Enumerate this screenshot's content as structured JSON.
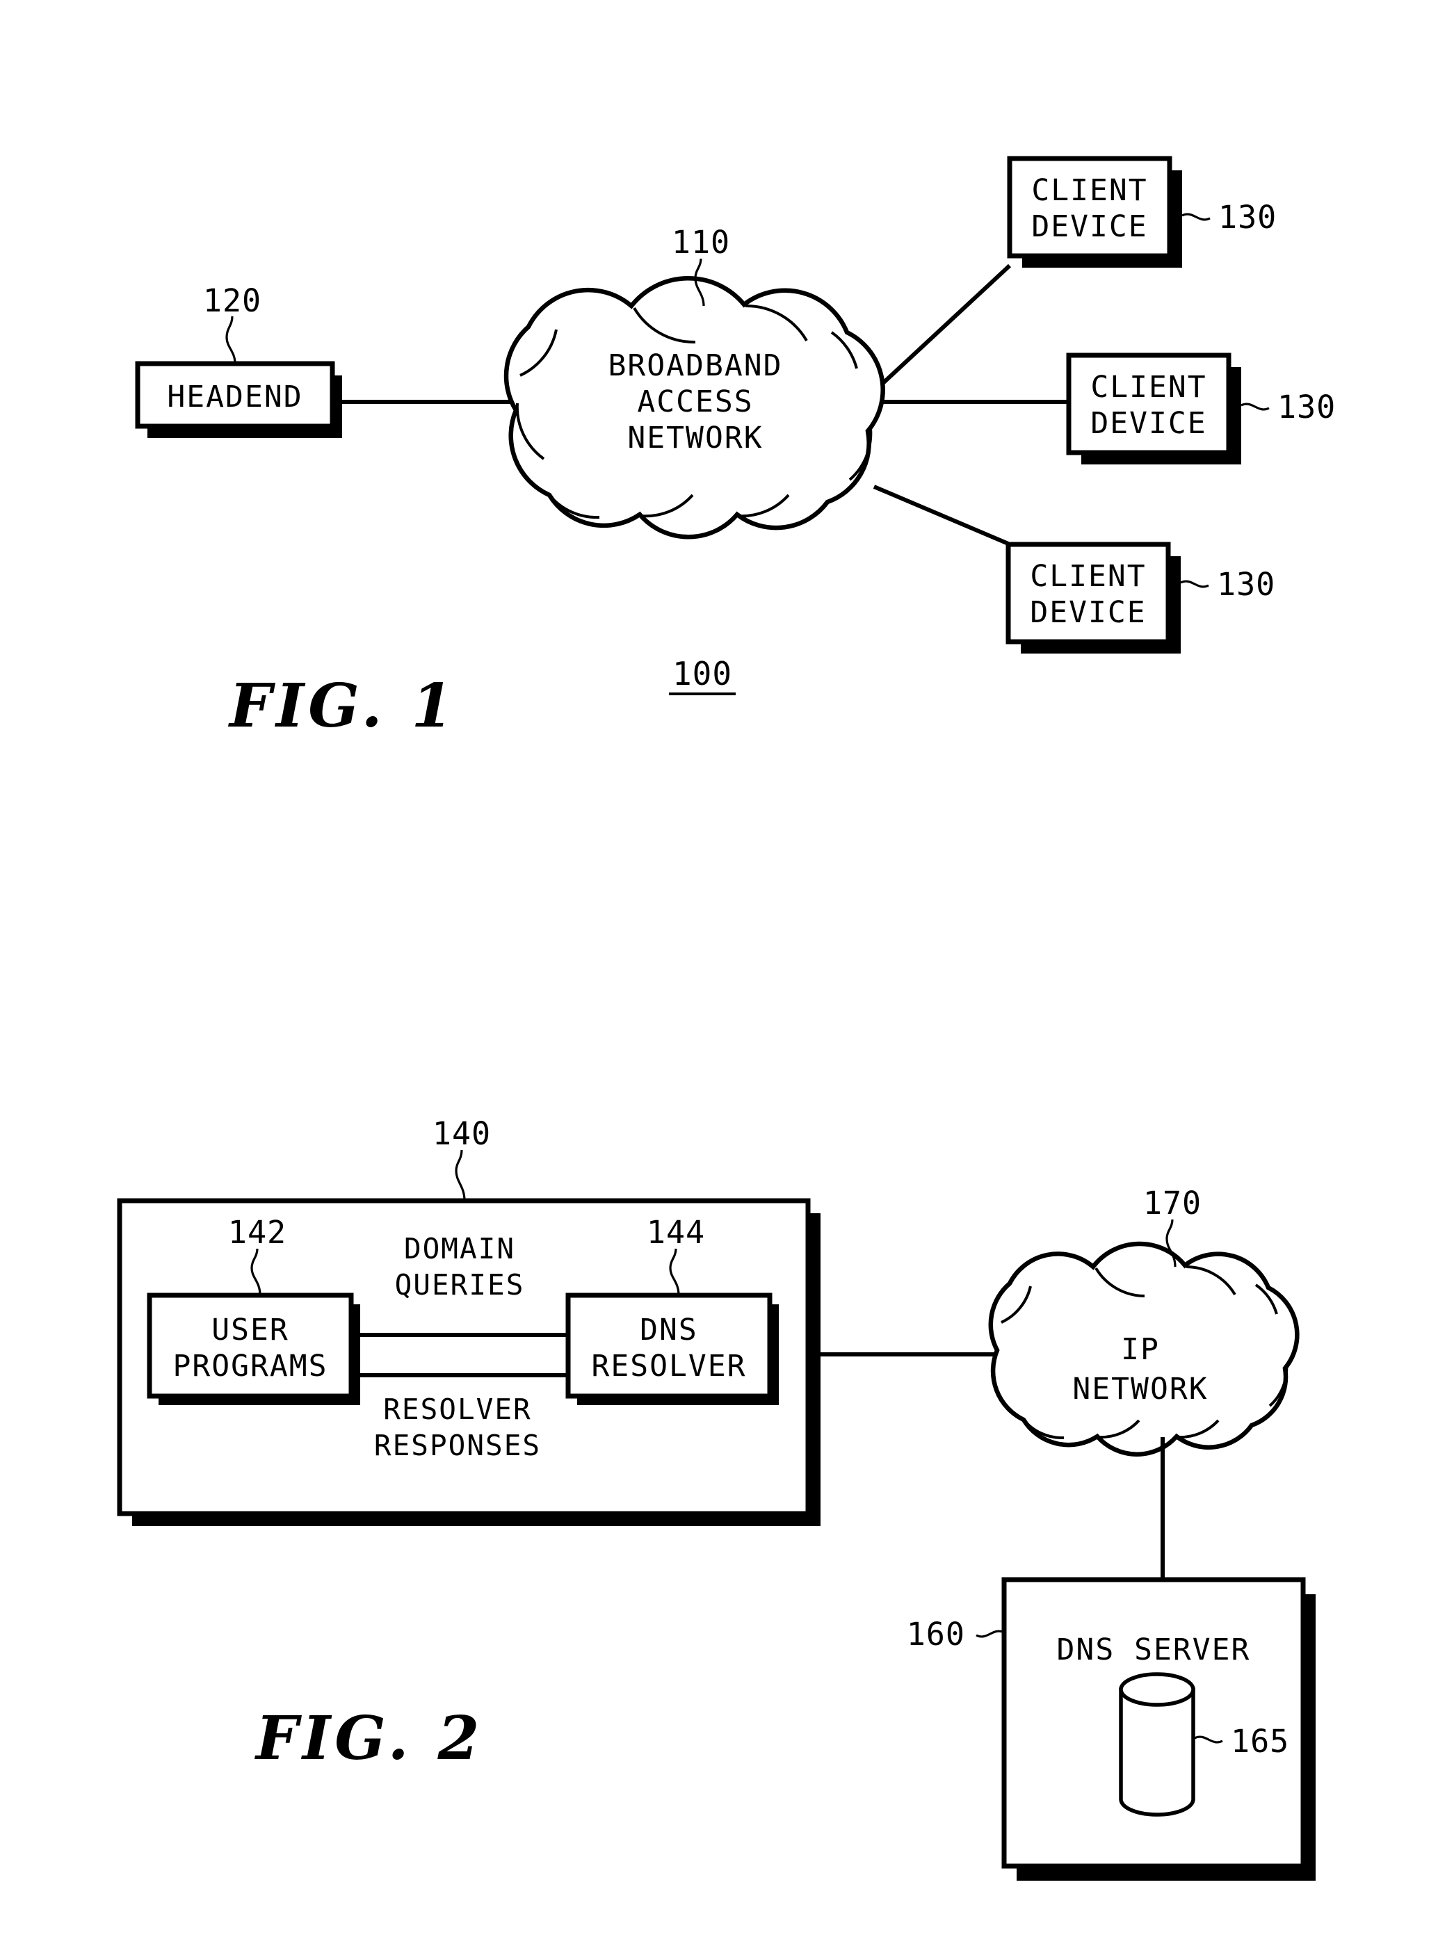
{
  "document": {
    "type": "patent-drawing-sheet",
    "figures": [
      {
        "id": "fig1",
        "title": "FIG. 1",
        "system_number": "100",
        "nodes": [
          {
            "name": "headend",
            "label": "HEADEND",
            "ref": "120",
            "shape": "box"
          },
          {
            "name": "broadband-access-network",
            "label_lines": [
              "BROADBAND",
              "ACCESS",
              "NETWORK"
            ],
            "ref": "110",
            "shape": "cloud"
          },
          {
            "name": "client-device-1",
            "label_lines": [
              "CLIENT",
              "DEVICE"
            ],
            "ref": "130",
            "shape": "box"
          },
          {
            "name": "client-device-2",
            "label_lines": [
              "CLIENT",
              "DEVICE"
            ],
            "ref": "130",
            "shape": "box"
          },
          {
            "name": "client-device-3",
            "label_lines": [
              "CLIENT",
              "DEVICE"
            ],
            "ref": "130",
            "shape": "box"
          }
        ]
      },
      {
        "id": "fig2",
        "title": "FIG. 2",
        "nodes": [
          {
            "name": "client-container",
            "ref": "140",
            "shape": "box"
          },
          {
            "name": "user-programs",
            "label_lines": [
              "USER",
              "PROGRAMS"
            ],
            "ref": "142",
            "shape": "box"
          },
          {
            "name": "dns-resolver",
            "label_lines": [
              "DNS",
              "RESOLVER"
            ],
            "ref": "144",
            "shape": "box"
          },
          {
            "name": "ip-network",
            "label_lines": [
              "IP",
              "NETWORK"
            ],
            "ref": "170",
            "shape": "cloud"
          },
          {
            "name": "dns-server",
            "label": "DNS SERVER",
            "ref": "160",
            "shape": "box"
          },
          {
            "name": "dns-database",
            "ref": "165",
            "shape": "cylinder"
          }
        ],
        "flows": [
          {
            "name": "domain-queries",
            "label_lines": [
              "DOMAIN",
              "QUERIES"
            ]
          },
          {
            "name": "resolver-responses",
            "label_lines": [
              "RESOLVER",
              "RESPONSES"
            ]
          }
        ]
      }
    ]
  },
  "fig1": {
    "title": "FIG. 1",
    "system_number": "100",
    "headend": {
      "label": "HEADEND",
      "ref": "120"
    },
    "cloud": {
      "line1": "BROADBAND",
      "line2": "ACCESS",
      "line3": "NETWORK",
      "ref": "110"
    },
    "client1": {
      "line1": "CLIENT",
      "line2": "DEVICE",
      "ref": "130"
    },
    "client2": {
      "line1": "CLIENT",
      "line2": "DEVICE",
      "ref": "130"
    },
    "client3": {
      "line1": "CLIENT",
      "line2": "DEVICE",
      "ref": "130"
    }
  },
  "fig2": {
    "title": "FIG. 2",
    "container": {
      "ref": "140"
    },
    "user_programs": {
      "line1": "USER",
      "line2": "PROGRAMS",
      "ref": "142"
    },
    "dns_resolver": {
      "line1": "DNS",
      "line2": "RESOLVER",
      "ref": "144"
    },
    "domain_queries": {
      "line1": "DOMAIN",
      "line2": "QUERIES"
    },
    "resolver_responses": {
      "line1": "RESOLVER",
      "line2": "RESPONSES"
    },
    "ip_network": {
      "line1": "IP",
      "line2": "NETWORK",
      "ref": "170"
    },
    "dns_server": {
      "label": "DNS SERVER",
      "ref": "160"
    },
    "dns_database": {
      "ref": "165"
    }
  },
  "colors": {
    "ink": "#000000",
    "paper": "#ffffff"
  }
}
